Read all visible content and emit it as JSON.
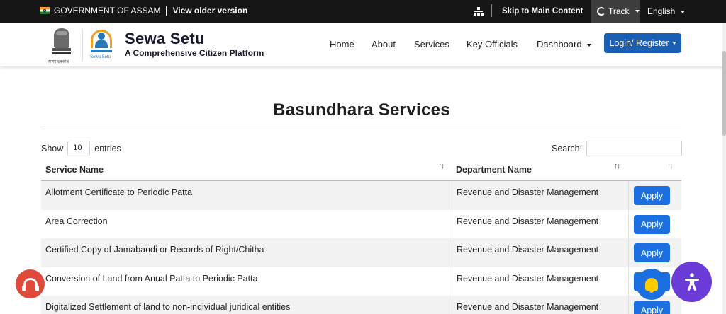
{
  "topbar": {
    "gov_label": "GOVERNMENT OF ASSAM",
    "older_version": "View older version",
    "skip": "Skip to Main Content",
    "track": "Track",
    "language": "English"
  },
  "header": {
    "brand_name": "Sewa Setu",
    "brand_tagline": "A Comprehensive Citizen Platform",
    "emblem_caption": "অসম চৰকাৰ",
    "logo_caption": "Sewa Setu",
    "nav": {
      "home": "Home",
      "about": "About",
      "services": "Services",
      "key_officials": "Key Officials",
      "dashboard": "Dashboard"
    },
    "login": "Login/ Register"
  },
  "page": {
    "title": "Basundhara Services",
    "show_label": "Show",
    "entries_value": "10",
    "entries_label": "entries",
    "search_label": "Search:"
  },
  "table": {
    "headers": [
      "Service Name",
      "Department Name"
    ],
    "rows": [
      {
        "service": "Allotment Certificate to Periodic Patta",
        "department": "Revenue and Disaster Management",
        "action": "Apply"
      },
      {
        "service": "Area Correction",
        "department": "Revenue and Disaster Management",
        "action": "Apply"
      },
      {
        "service": "Certified Copy of Jamabandi or Records of Right/Chitha",
        "department": "Revenue and Disaster Management",
        "action": "Apply"
      },
      {
        "service": "Conversion of Land from Anual Patta to Periodic Patta",
        "department": "Revenue and Disaster Management",
        "action": "Apply"
      },
      {
        "service": "Digitalized Settlement of land to non-individual juridical entities",
        "department": "Revenue and Disaster Management",
        "action": "Apply"
      }
    ]
  },
  "colors": {
    "topbar_bg": "#161616",
    "login_bg": "#1b5fb4",
    "apply_bg": "#1b6fe0",
    "support_bg": "#e04a3c",
    "accessibility_bg": "#6a3bd6"
  },
  "icons": {
    "sitemap": "sitemap-icon",
    "track": "refresh-circle-icon",
    "support": "headset-icon",
    "notifications": "bell-icon",
    "accessibility": "accessibility-person-icon"
  }
}
